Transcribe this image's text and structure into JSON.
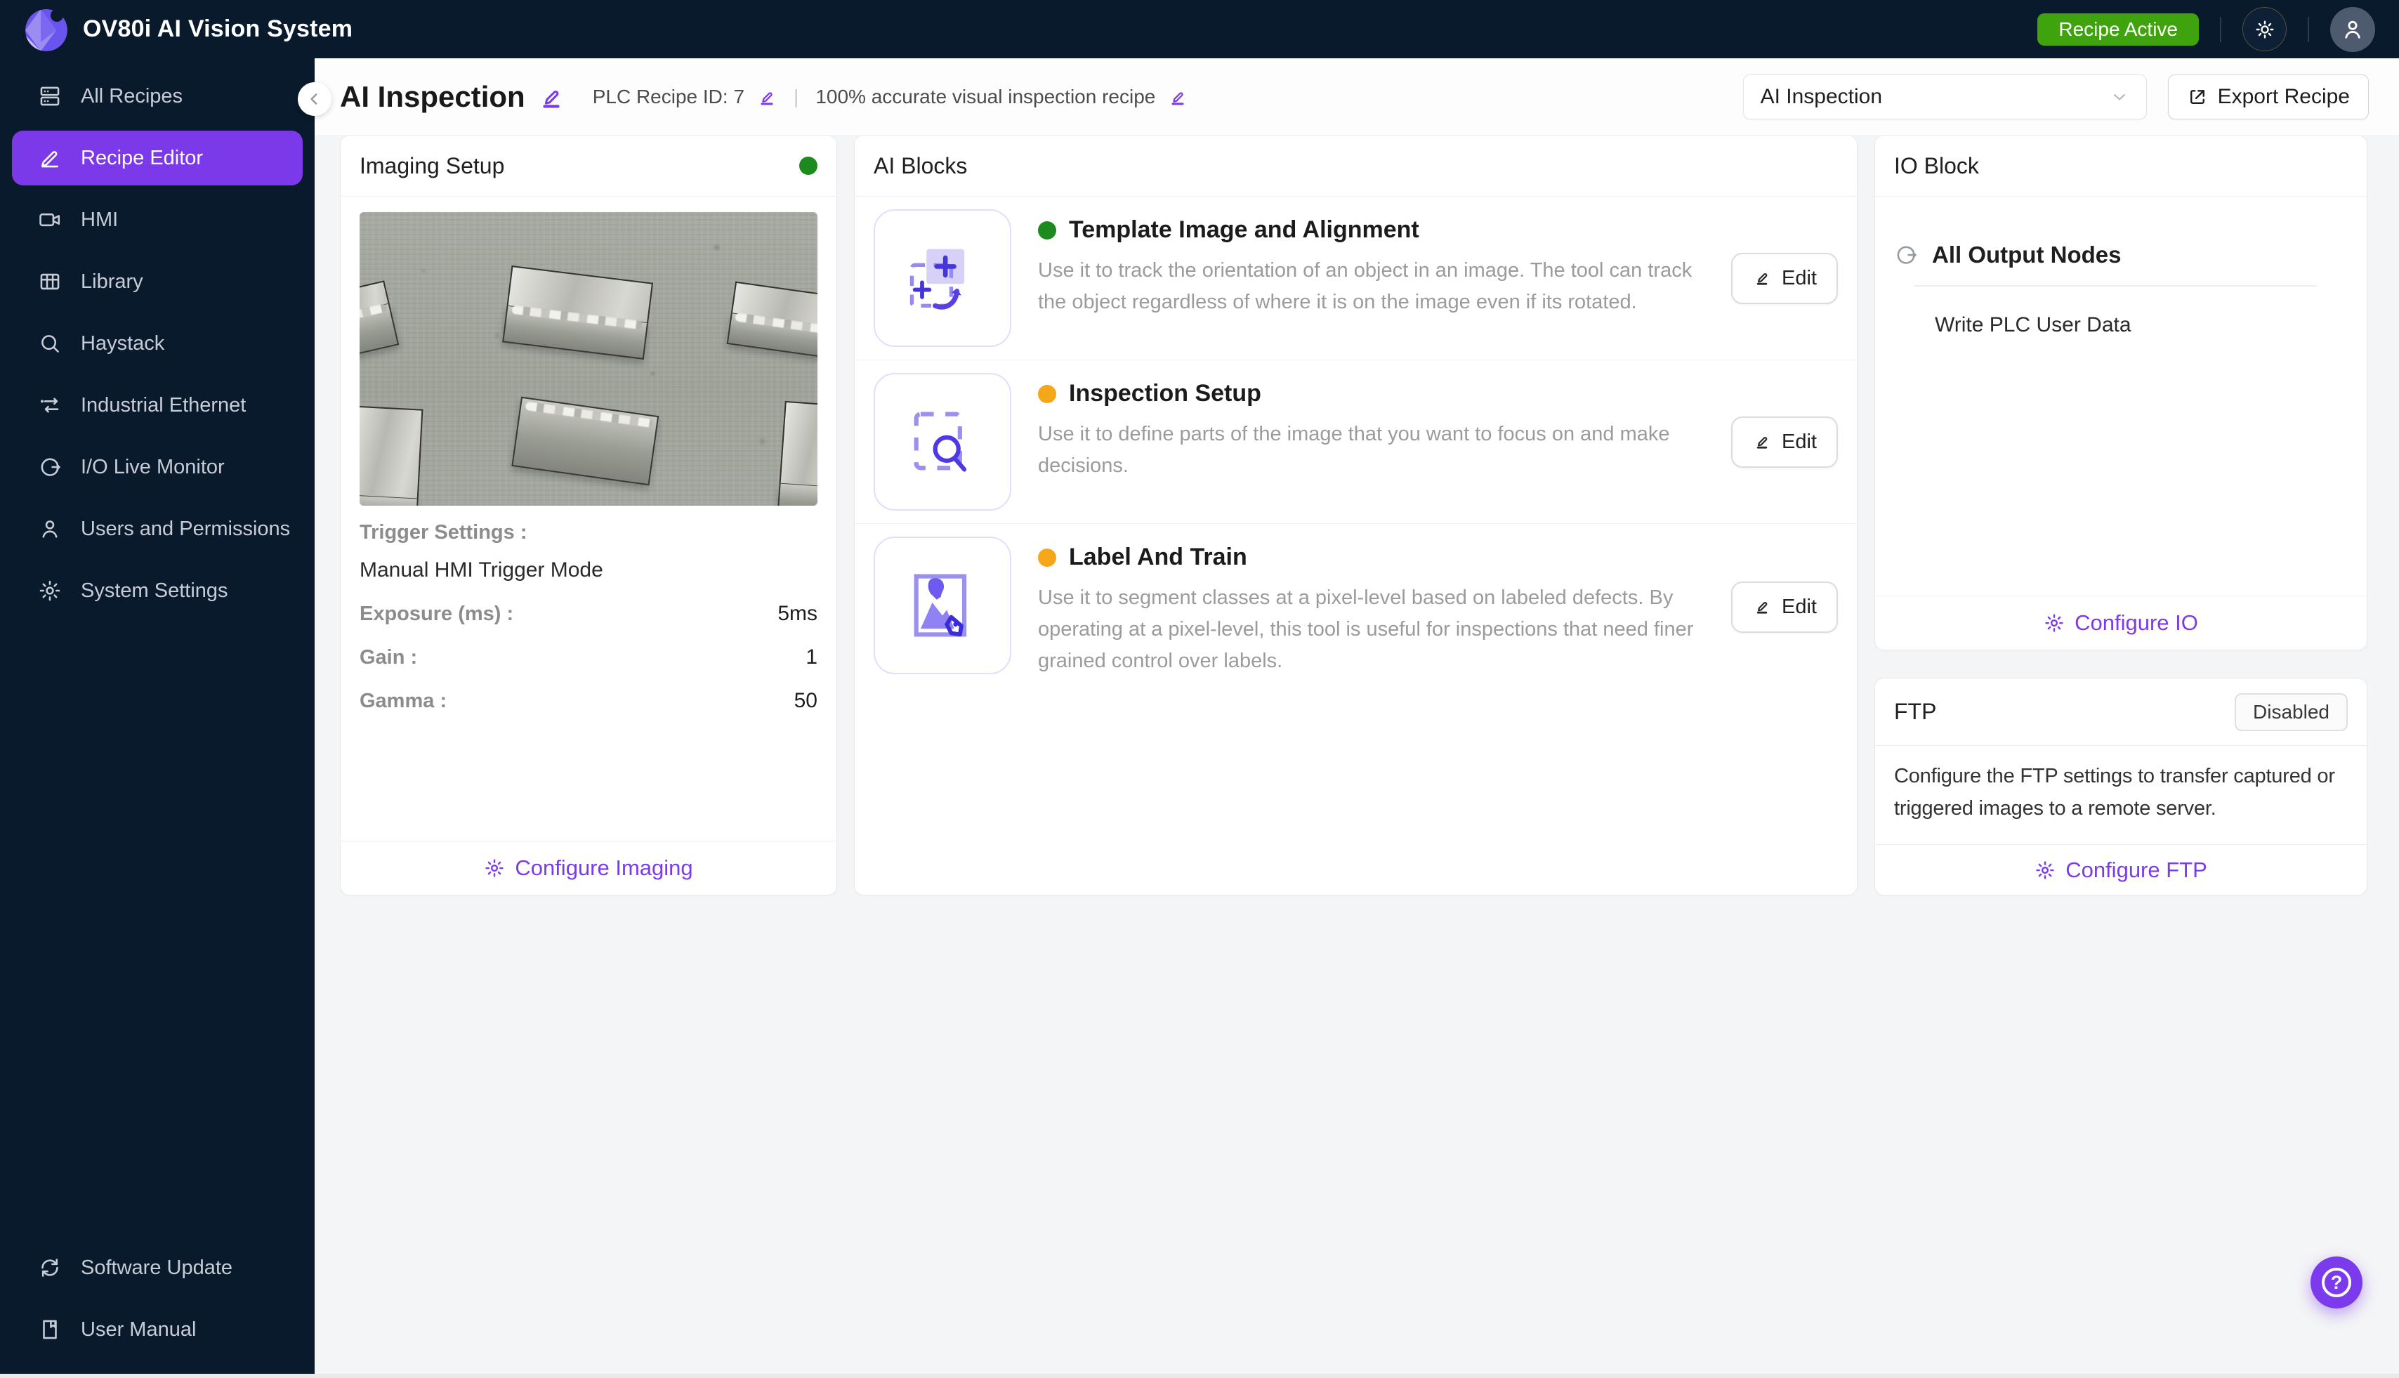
{
  "topbar": {
    "title": "OV80i AI Vision System",
    "status_badge": "Recipe Active"
  },
  "sidebar": {
    "items": [
      {
        "label": "All Recipes",
        "icon": "recipes-icon"
      },
      {
        "label": "Recipe Editor",
        "icon": "recipe-editor-icon",
        "active": true
      },
      {
        "label": "HMI",
        "icon": "hmi-camera-icon"
      },
      {
        "label": "Library",
        "icon": "library-grid-icon"
      },
      {
        "label": "Haystack",
        "icon": "search-icon"
      },
      {
        "label": "Industrial Ethernet",
        "icon": "ethernet-swap-icon"
      },
      {
        "label": "I/O Live Monitor",
        "icon": "io-monitor-icon"
      },
      {
        "label": "Users and Permissions",
        "icon": "user-icon"
      },
      {
        "label": "System Settings",
        "icon": "gear-icon"
      }
    ],
    "bottom_items": [
      {
        "label": "Software Update",
        "icon": "refresh-icon"
      },
      {
        "label": "User Manual",
        "icon": "book-icon"
      }
    ]
  },
  "page_header": {
    "title": "AI Inspection",
    "plc_label": "PLC Recipe ID: 7",
    "separator": "|",
    "description": "100% accurate visual inspection recipe",
    "recipe_select_value": "AI Inspection",
    "export_label": "Export Recipe"
  },
  "imaging": {
    "title": "Imaging Setup",
    "status_style": "background:#1d8a1d",
    "trigger_label": "Trigger Settings :",
    "trigger_mode": "Manual HMI Trigger Mode",
    "rows": [
      {
        "label": "Exposure (ms) :",
        "value": "5ms"
      },
      {
        "label": "Gain :",
        "value": "1"
      },
      {
        "label": "Gamma :",
        "value": "50"
      }
    ],
    "configure_label": "Configure Imaging"
  },
  "ai": {
    "title": "AI Blocks",
    "edit_label": "Edit",
    "blocks": [
      {
        "name": "Template Image and Alignment",
        "status_style": "background:#1d8a1d",
        "description": "Use it to track the orientation of an object in an image. The tool can track the object regardless of where it is on the image even if its rotated.",
        "icon": "template-alignment-icon"
      },
      {
        "name": "Inspection Setup",
        "status_style": "background:#f5a718",
        "description": "Use it to define parts of the image that you want to focus on and make decisions.",
        "icon": "inspection-setup-icon"
      },
      {
        "name": "Label And Train",
        "status_style": "background:#f5a718",
        "description": "Use it to segment classes at a pixel-level based on labeled defects. By operating at a pixel-level, this tool is useful for inspections that need finer grained control over labels.",
        "icon": "label-train-icon"
      }
    ]
  },
  "io": {
    "title": "IO Block",
    "section_title": "All Output Nodes",
    "nodes": [
      "Write PLC User Data"
    ],
    "configure_label": "Configure IO"
  },
  "ftp": {
    "title": "FTP",
    "status": "Disabled",
    "description": "Configure the FTP settings to transfer captured or triggered images to a remote server.",
    "configure_label": "Configure FTP"
  },
  "help": {
    "glyph": "?"
  },
  "colors": {
    "accent_purple": "#7c3aed",
    "sidebar_bg": "#091a2c",
    "badge_green": "#3fa30d",
    "status_green": "#1d8a1d",
    "status_orange": "#f5a718"
  }
}
